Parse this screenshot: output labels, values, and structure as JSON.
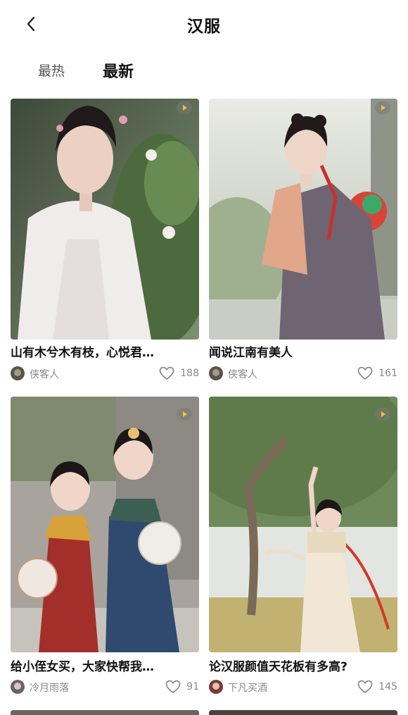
{
  "header": {
    "title": "汉服",
    "back_icon": "chevron-left-icon"
  },
  "tabs": [
    {
      "label": "最热",
      "active": false
    },
    {
      "label": "最新",
      "active": true
    }
  ],
  "posts": [
    {
      "title": "山有木兮木有枝，心悦君…",
      "author": "侠客人",
      "likes": "188",
      "video": true,
      "accent": "#e9e4e1"
    },
    {
      "title": "闻说江南有美人",
      "author": "侠客人",
      "likes": "161",
      "video": true,
      "accent": "#6f6572"
    },
    {
      "title": "给小侄女买，大家快帮我…",
      "author": "冷月雨落",
      "likes": "91",
      "video": true,
      "accent": "#2f4a6e"
    },
    {
      "title": "论汉服颜值天花板有多高?",
      "author": "下凡买酒",
      "likes": "145",
      "video": true,
      "accent": "#f2e6d6"
    }
  ],
  "colors": {
    "text": "#111111",
    "muted": "#8a8a8a",
    "play": "#f3c22b"
  }
}
